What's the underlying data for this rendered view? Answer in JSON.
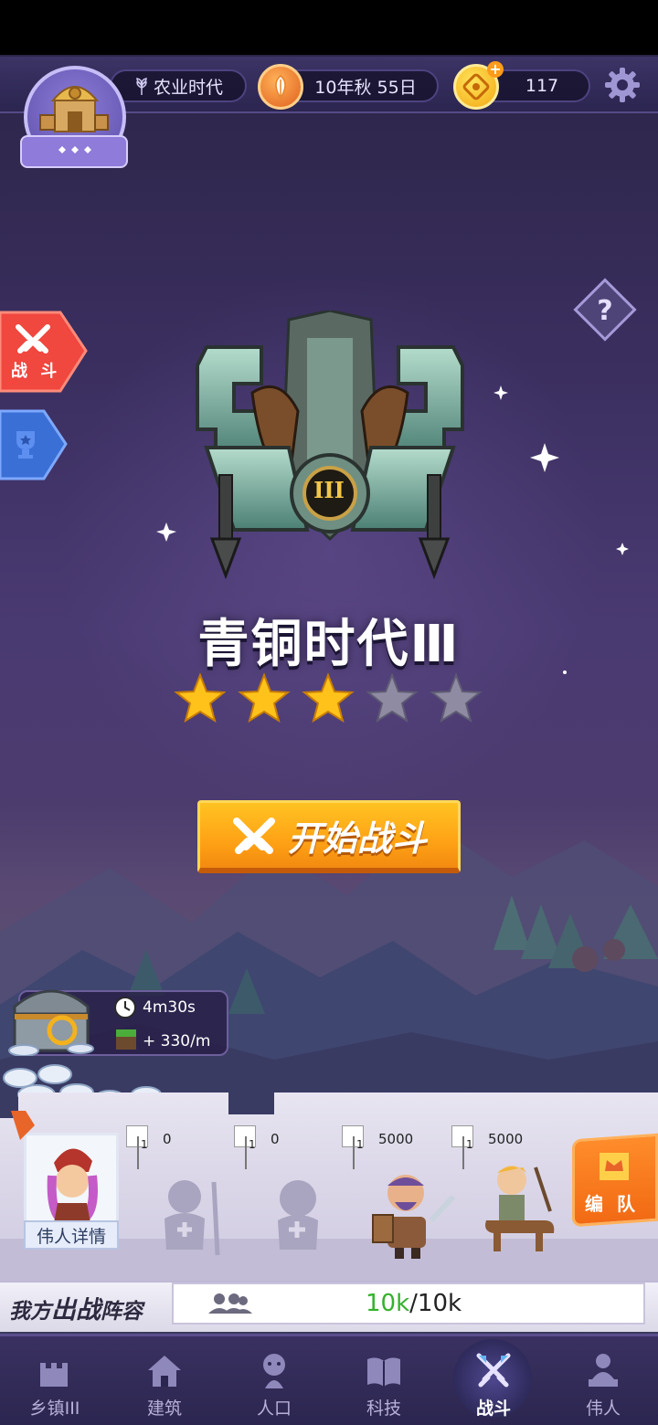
{
  "topbar": {
    "era_label": "农业时代",
    "date_label": "10年秋 55日",
    "currency_value": "117",
    "icons": [
      "wheat-icon",
      "leaf-icon",
      "coin-icon",
      "gear-icon"
    ]
  },
  "side_tabs": [
    {
      "label": "战\n斗",
      "icon": "crossed-swords-icon"
    },
    {
      "label": "",
      "icon": "trophy-icon"
    }
  ],
  "stage": {
    "title": "青铜时代Ⅲ",
    "badge": "III",
    "stars_filled": 3,
    "stars_total": 5
  },
  "start_button": {
    "label": "开始战斗"
  },
  "chest": {
    "timer": "4m30s",
    "rate": "+ 330/m"
  },
  "lineup": {
    "hero_card_label": "伟人详情",
    "slots": [
      {
        "count": "0",
        "sub": "1"
      },
      {
        "count": "0",
        "sub": "1"
      },
      {
        "count": "5000",
        "sub": "1"
      },
      {
        "count": "5000",
        "sub": "1"
      }
    ],
    "formation_label": "编 队",
    "title": "我方出战阵容",
    "power_current": "10k",
    "power_max": "/10k"
  },
  "nav": [
    {
      "label": "乡镇III",
      "icon": "castle-icon"
    },
    {
      "label": "建筑",
      "icon": "house-icon"
    },
    {
      "label": "人口",
      "icon": "person-icon"
    },
    {
      "label": "科技",
      "icon": "book-icon"
    },
    {
      "label": "战斗",
      "icon": "crossed-swords-icon",
      "active": true
    },
    {
      "label": "伟人",
      "icon": "statue-icon"
    }
  ],
  "colors": {
    "accent_orange": "#ffa216",
    "star_gold": "#ffc21a",
    "star_empty": "#8e8ba3",
    "power_green": "#35b12c"
  }
}
